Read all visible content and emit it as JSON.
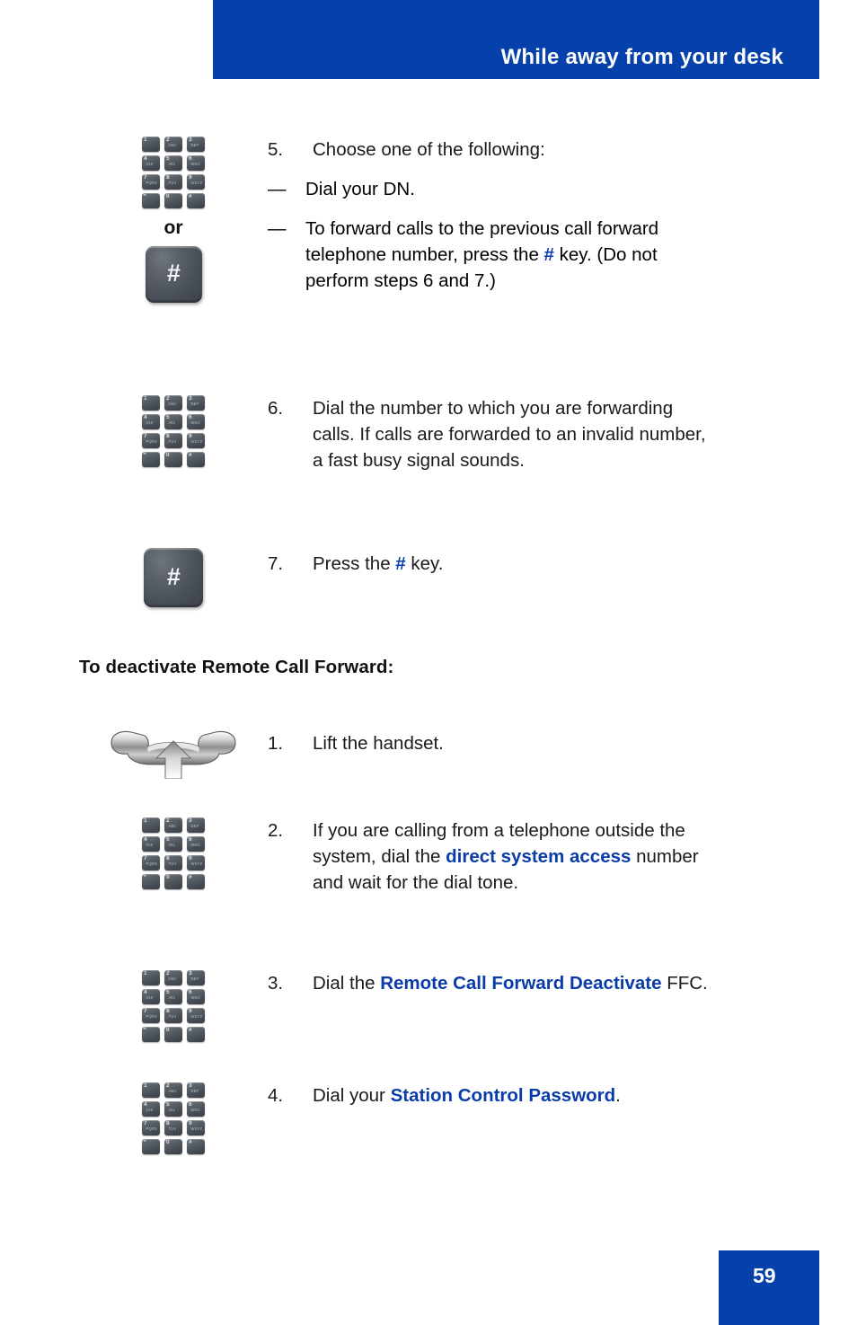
{
  "header": {
    "title": "While away from your desk",
    "bar_color": "#0540ab"
  },
  "colors": {
    "accent_blue": "#0540ab",
    "text_blue": "#0a3ca9",
    "body_text": "#1a1a1a"
  },
  "icons": {
    "keypad": {
      "name": "dialpad-icon",
      "keys": [
        {
          "glyph": "1",
          "sub": ""
        },
        {
          "glyph": "2",
          "sub": "ABC"
        },
        {
          "glyph": "3",
          "sub": "DEF"
        },
        {
          "glyph": "4",
          "sub": "GHI"
        },
        {
          "glyph": "5",
          "sub": "JKL"
        },
        {
          "glyph": "6",
          "sub": "MNO"
        },
        {
          "glyph": "7",
          "sub": "PQRS"
        },
        {
          "glyph": "8",
          "sub": "TUV"
        },
        {
          "glyph": "9",
          "sub": "WXYZ"
        },
        {
          "glyph": "*",
          "sub": ""
        },
        {
          "glyph": "0",
          "sub": ""
        },
        {
          "glyph": "#",
          "sub": ""
        }
      ]
    },
    "hash_key": {
      "name": "pound-key-icon",
      "label": "#"
    },
    "handset": {
      "name": "lift-handset-icon"
    },
    "or_label": "or"
  },
  "section_1": {
    "steps": [
      {
        "number": "5.",
        "text": "Choose one of the following:",
        "sub_items": [
          {
            "dash": "—",
            "text": "Dial your DN."
          },
          {
            "dash": "—",
            "prefix": "To forward calls to the previous call forward telephone number, press the ",
            "highlight": "#",
            "suffix": " key. (Do not perform steps 6 and 7.)"
          }
        ]
      },
      {
        "number": "6.",
        "text": "Dial the number to which you are forwarding calls. If calls are forwarded to an invalid number, a fast busy signal sounds."
      },
      {
        "number": "7.",
        "prefix": "Press the ",
        "highlight": "#",
        "suffix": " key."
      }
    ]
  },
  "section_2": {
    "heading": "To deactivate Remote Call Forward:",
    "steps": [
      {
        "number": "1.",
        "text": "Lift the handset."
      },
      {
        "number": "2.",
        "prefix": "If you are calling from a telephone outside the system, dial the ",
        "highlight": "direct system access",
        "suffix": " number and wait for the dial tone."
      },
      {
        "number": "3.",
        "prefix": "Dial the ",
        "highlight": "Remote Call Forward Deactivate",
        "suffix": " FFC."
      },
      {
        "number": "4.",
        "prefix": "Dial your ",
        "highlight": "Station Control Password",
        "suffix": "."
      }
    ]
  },
  "footer": {
    "page_number": "59"
  }
}
